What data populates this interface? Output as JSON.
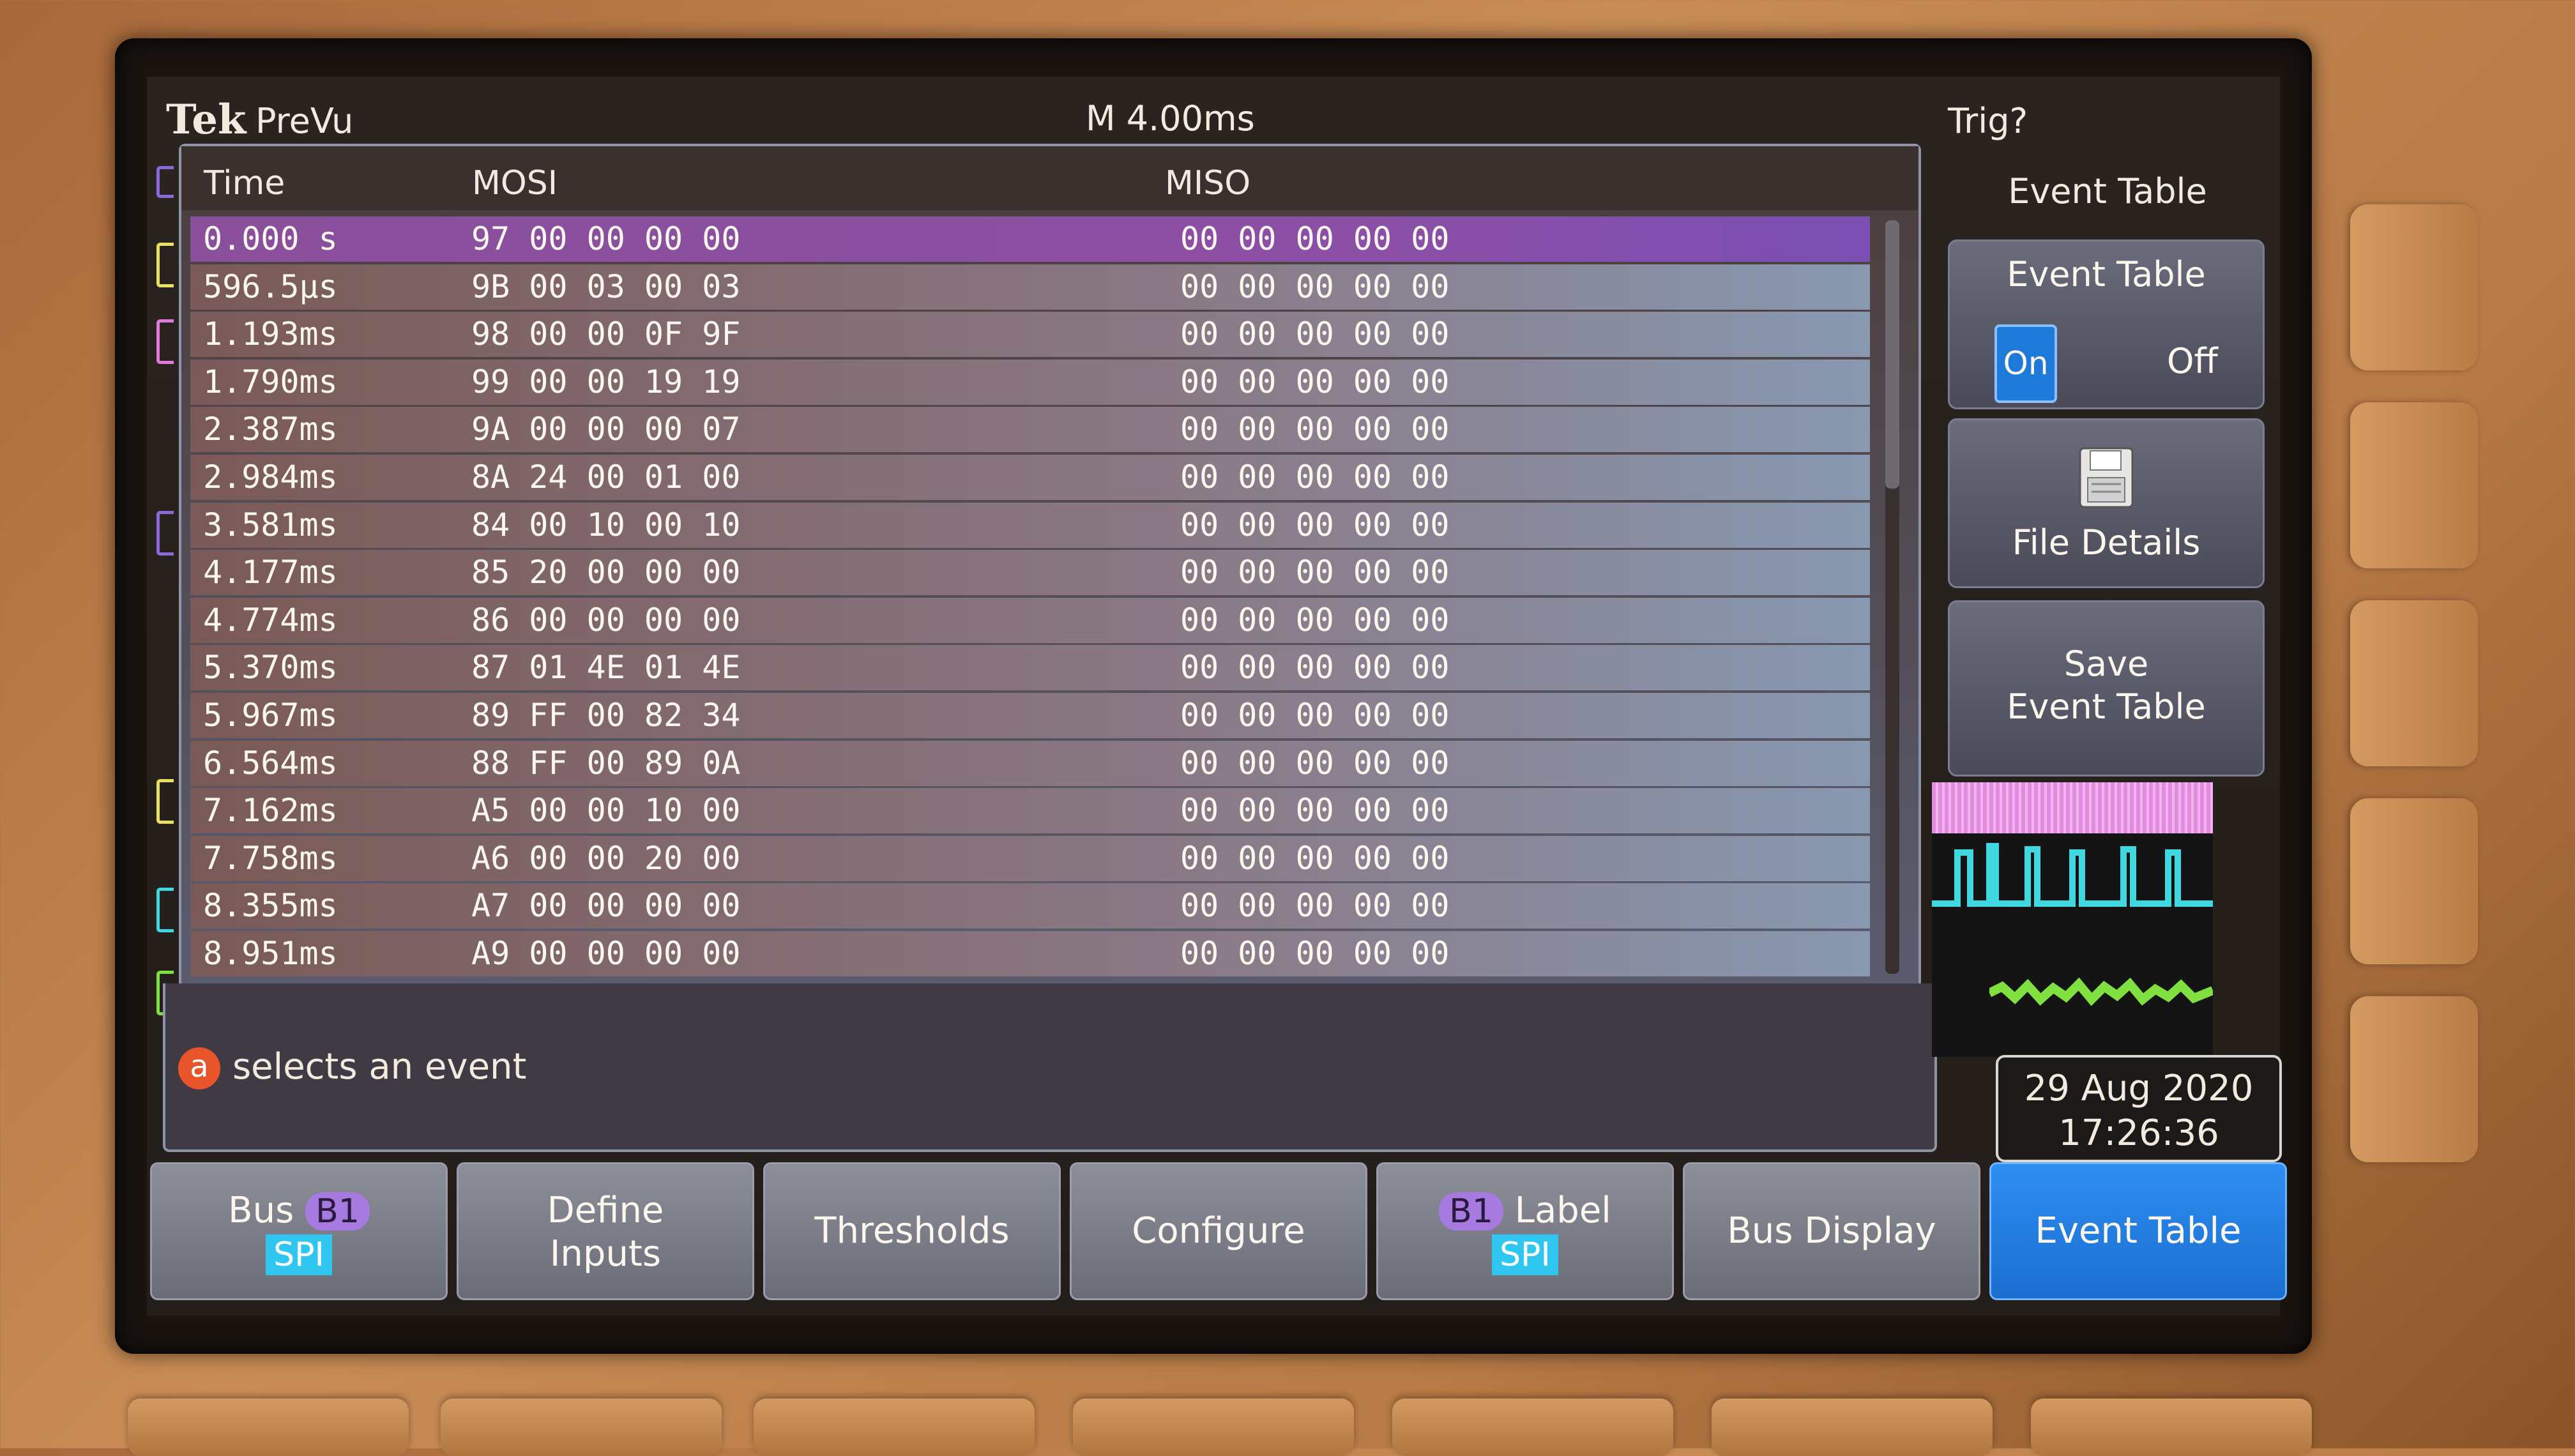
{
  "header": {
    "logo": "Tek",
    "mode": "PreVu",
    "timebase": "M 4.00ms",
    "trigger_status": "Trig?"
  },
  "event_table": {
    "columns": [
      "Time",
      "MOSI",
      "MISO"
    ],
    "rows": [
      {
        "time": "0.000 s",
        "mosi": "97 00 00 00 00",
        "miso": "00 00 00 00 00",
        "selected": true
      },
      {
        "time": "596.5µs",
        "mosi": "9B 00 03 00 03",
        "miso": "00 00 00 00 00"
      },
      {
        "time": "1.193ms",
        "mosi": "98 00 00 0F 9F",
        "miso": "00 00 00 00 00"
      },
      {
        "time": "1.790ms",
        "mosi": "99 00 00 19 19",
        "miso": "00 00 00 00 00"
      },
      {
        "time": "2.387ms",
        "mosi": "9A 00 00 00 07",
        "miso": "00 00 00 00 00"
      },
      {
        "time": "2.984ms",
        "mosi": "8A 24 00 01 00",
        "miso": "00 00 00 00 00"
      },
      {
        "time": "3.581ms",
        "mosi": "84 00 10 00 10",
        "miso": "00 00 00 00 00"
      },
      {
        "time": "4.177ms",
        "mosi": "85 20 00 00 00",
        "miso": "00 00 00 00 00"
      },
      {
        "time": "4.774ms",
        "mosi": "86 00 00 00 00",
        "miso": "00 00 00 00 00"
      },
      {
        "time": "5.370ms",
        "mosi": "87 01 4E 01 4E",
        "miso": "00 00 00 00 00"
      },
      {
        "time": "5.967ms",
        "mosi": "89 FF 00 82 34",
        "miso": "00 00 00 00 00"
      },
      {
        "time": "6.564ms",
        "mosi": "88 FF 00 89 0A",
        "miso": "00 00 00 00 00"
      },
      {
        "time": "7.162ms",
        "mosi": "A5 00 00 10 00",
        "miso": "00 00 00 00 00"
      },
      {
        "time": "7.758ms",
        "mosi": "A6 00 00 20 00",
        "miso": "00 00 00 00 00"
      },
      {
        "time": "8.355ms",
        "mosi": "A7 00 00 00 00",
        "miso": "00 00 00 00 00"
      },
      {
        "time": "8.951ms",
        "mosi": "A9 00 00 00 00",
        "miso": "00 00 00 00 00"
      }
    ],
    "hint_icon": "a",
    "hint_text": "selects an event"
  },
  "side_menu": {
    "title": "Event Table",
    "toggle": {
      "label": "Event Table",
      "on": "On",
      "off": "Off",
      "value": "On"
    },
    "file_details": "File Details",
    "save_line1": "Save",
    "save_line2": "Event Table"
  },
  "datetime": {
    "date": "29 Aug 2020",
    "time": "17:26:36"
  },
  "bottom_menu": {
    "bus_label": "Bus",
    "bus_id": "B1",
    "bus_type": "SPI",
    "define_l1": "Define",
    "define_l2": "Inputs",
    "thresholds": "Thresholds",
    "configure": "Configure",
    "label_id": "B1",
    "label_text": "Label",
    "label_type": "SPI",
    "bus_display": "Bus Display",
    "event_table": "Event Table"
  },
  "colors": {
    "selected_row": "#8c4fa6",
    "active_button": "#1a6ed0",
    "on_pill": "#1d7ad8",
    "hint_icon": "#e8552a"
  }
}
